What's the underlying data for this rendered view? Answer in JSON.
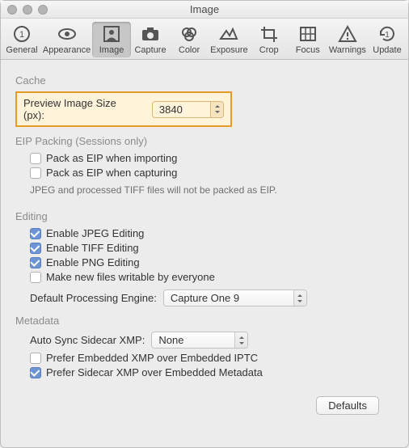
{
  "window": {
    "title": "Image"
  },
  "toolbar": {
    "items": [
      {
        "label": "General"
      },
      {
        "label": "Appearance"
      },
      {
        "label": "Image"
      },
      {
        "label": "Capture"
      },
      {
        "label": "Color"
      },
      {
        "label": "Exposure"
      },
      {
        "label": "Crop"
      },
      {
        "label": "Focus"
      },
      {
        "label": "Warnings"
      },
      {
        "label": "Update"
      }
    ]
  },
  "sections": {
    "cache": {
      "header": "Cache",
      "preview_label": "Preview Image Size (px):",
      "preview_value": "3840"
    },
    "eip": {
      "header": "EIP Packing (Sessions only)",
      "pack_import": "Pack as EIP when importing",
      "pack_capture": "Pack as EIP when capturing",
      "note": "JPEG and processed TIFF files will not be packed as EIP."
    },
    "editing": {
      "header": "Editing",
      "enable_jpeg": "Enable JPEG Editing",
      "enable_tiff": "Enable TIFF Editing",
      "enable_png": "Enable PNG Editing",
      "writable": "Make new files writable by everyone",
      "engine_label": "Default Processing Engine:",
      "engine_value": "Capture One 9"
    },
    "metadata": {
      "header": "Metadata",
      "sync_label": "Auto Sync Sidecar XMP:",
      "sync_value": "None",
      "prefer_embedded": "Prefer Embedded XMP over Embedded IPTC",
      "prefer_sidecar": "Prefer Sidecar XMP over Embedded Metadata"
    }
  },
  "footer": {
    "defaults": "Defaults"
  }
}
